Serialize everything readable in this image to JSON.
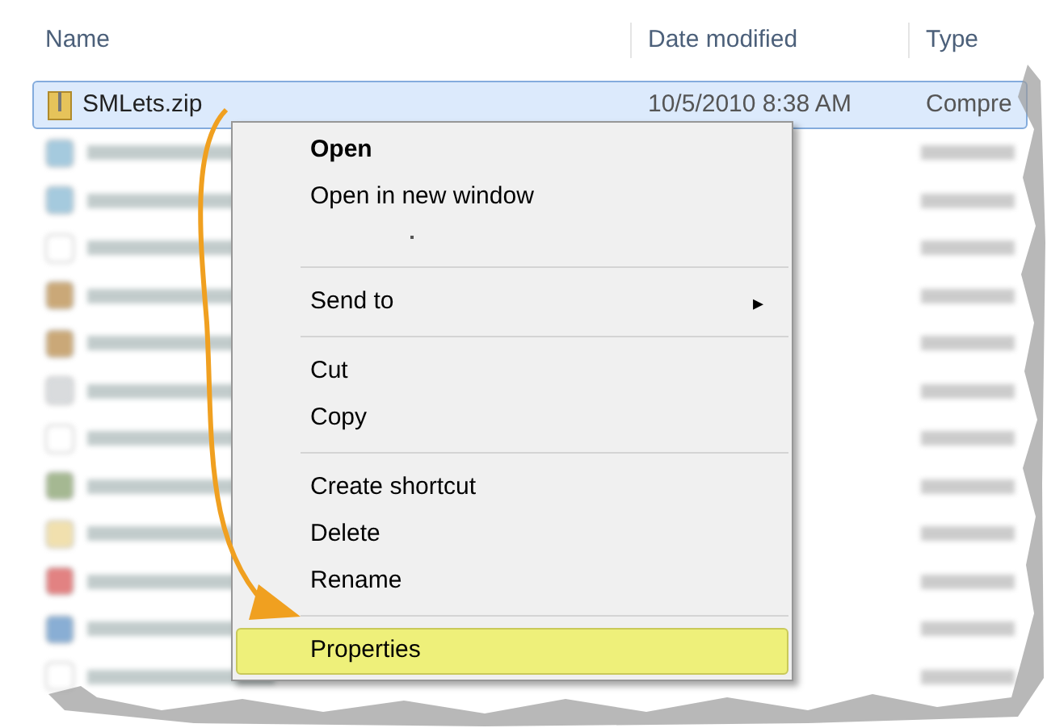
{
  "file_list": {
    "columns": [
      "Name",
      "Date modified",
      "Type"
    ],
    "rows": [
      {
        "name": "SMLets.zip",
        "date_modified": "10/5/2010 8:38 AM",
        "type": "Compre",
        "selected": true
      }
    ]
  },
  "context_menu": {
    "items": [
      {
        "kind": "default",
        "label": "Open",
        "selected": false
      },
      {
        "kind": "item",
        "label": "Open in new window",
        "selected": false
      },
      {
        "kind": "hidden",
        "selected": false
      },
      {
        "kind": "separator"
      },
      {
        "kind": "submenu",
        "label": "Send to",
        "arrow": "▸",
        "selected": false
      },
      {
        "kind": "separator"
      },
      {
        "kind": "item",
        "label": "Cut",
        "selected": false
      },
      {
        "kind": "item",
        "label": "Copy",
        "selected": false
      },
      {
        "kind": "separator"
      },
      {
        "kind": "item",
        "label": "Create shortcut",
        "selected": false
      },
      {
        "kind": "item",
        "label": "Delete",
        "selected": false
      },
      {
        "kind": "item",
        "label": "Rename",
        "selected": false
      },
      {
        "kind": "separator"
      },
      {
        "kind": "item",
        "label": "Properties",
        "selected": true
      }
    ]
  }
}
